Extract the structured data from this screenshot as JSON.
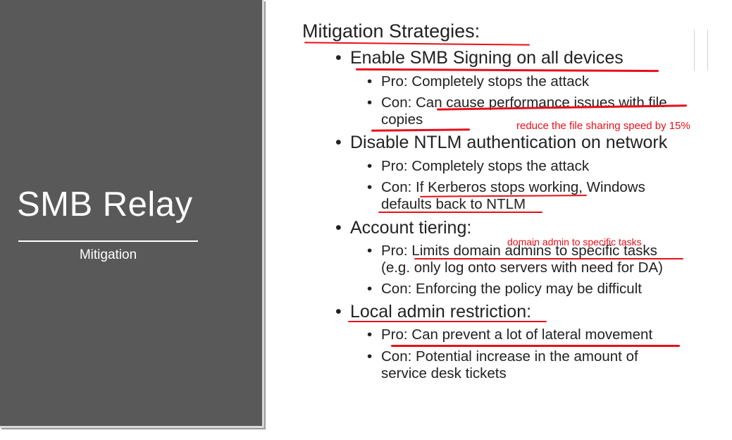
{
  "left": {
    "title": "SMB Relay",
    "subtitle": "Mitigation"
  },
  "slide": {
    "heading": "Mitigation Strategies:",
    "bullet_char": "•",
    "strategies": [
      {
        "title": "Enable SMB Signing on all devices",
        "pro": "Pro: Completely stops the attack",
        "con_lines": [
          "Con: Can cause performance issues with file",
          "copies"
        ]
      },
      {
        "title": "Disable NTLM authentication on network",
        "pro": "Pro: Completely stops the attack",
        "con_lines": [
          "Con: If Kerberos stops working, Windows",
          "defaults back to NTLM"
        ]
      },
      {
        "title": "Account tiering:",
        "pro_lines": [
          "Pro: Limits domain admins to specific tasks",
          "(e.g. only log onto servers with need for DA)"
        ],
        "con": "Con: Enforcing the policy may be difficult"
      },
      {
        "title": "Local admin restriction:",
        "pro": "Pro: Can prevent a lot of lateral movement",
        "con_lines": [
          "Con: Potential increase in the amount of",
          "service desk tickets"
        ]
      }
    ]
  },
  "annotations": {
    "note_smb_signing": "reduce the file sharing speed by 15%",
    "note_tiering": "domain admin to specific tasks",
    "color": "#e8101a"
  }
}
